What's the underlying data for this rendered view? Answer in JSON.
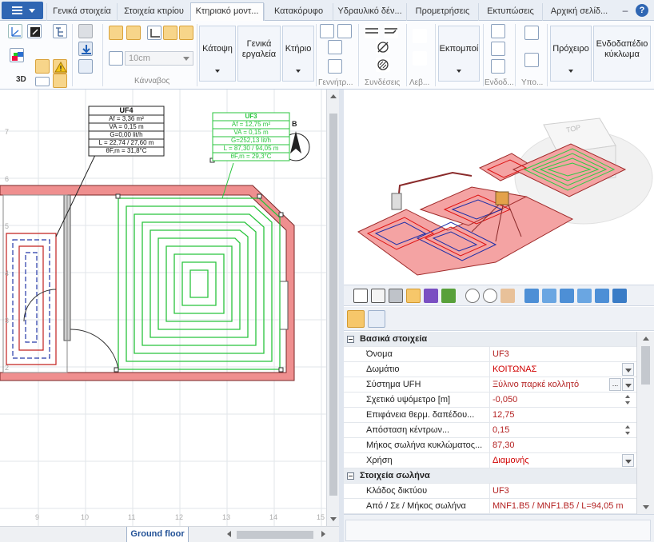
{
  "tabs": [
    {
      "label": "Γενικά στοιχεία",
      "active": false
    },
    {
      "label": "Στοιχεία κτιρίου",
      "active": false
    },
    {
      "label": "Κτηριακό μοντ...",
      "active": true
    },
    {
      "label": "Κατακόρυφο",
      "active": false
    },
    {
      "label": "Υδραυλικό δέν...",
      "active": false
    },
    {
      "label": "Προμετρήσεις",
      "active": false
    },
    {
      "label": "Εκτυπώσεις",
      "active": false
    },
    {
      "label": "Αρχική σελίδ...",
      "active": false
    }
  ],
  "window_controls": {
    "minimize": "–",
    "help": "?"
  },
  "ribbon": {
    "label_3d": "3D",
    "thickness_value": "10cm",
    "group_canvas": "Κάνναβος",
    "btn_katopsi": "Κάτοψη",
    "btn_genika_line1": "Γενικά",
    "btn_genika_line2": "εργαλεία",
    "btn_ktirio": "Κτήριο",
    "group_generators": "Γεννήτρ...",
    "group_connections": "Συνδέσεις",
    "group_boilers": "Λεβ...",
    "btn_emitters": "Εκπομποί",
    "group_endod": "Ενδοδ...",
    "group_ypo": "Υπο...",
    "btn_draft": "Πρόχειρο",
    "btn_floor_line1": "Ενδοδαπέδιο",
    "btn_floor_line2": "κύκλωμα"
  },
  "plan": {
    "box_uf4": {
      "title": "UF4",
      "lines": [
        "Af = 3,36 m²",
        "VA = 0,15 m",
        "G=0,00 lit/h",
        "L = 22,74 / 27,60 m",
        "θF,m = 31,8°C"
      ]
    },
    "box_uf3": {
      "title": "UF3",
      "lines": [
        "Af = 12,75 m²",
        "VA = 0,15 m",
        "G=252,13 lit/h",
        "L = 87,30 / 94,05 m",
        "θF,m = 29,3°C"
      ]
    },
    "north_label": "B",
    "ruler_left": [
      "7",
      "6",
      "5",
      "4",
      "3",
      "2"
    ],
    "ruler_bottom": [
      "9",
      "10",
      "11",
      "12",
      "13",
      "14",
      "15"
    ],
    "floor_tab": "Ground floor"
  },
  "view3d": {
    "top_label": "TOP"
  },
  "properties": {
    "categories": [
      "Βασικά στοιχεία",
      "Στοιχεία σωλήνα"
    ],
    "rows": [
      {
        "name": "Όνομα",
        "value": "UF3"
      },
      {
        "name": "Δωμάτιο",
        "value": "ΚΟΙΤΩΝΑΣ"
      },
      {
        "name": "Σύστημα UFH",
        "value": "Ξύλινο παρκέ κολλητό"
      },
      {
        "name": "Σχετικό υψόμετρο [m]",
        "value": "-0,050"
      },
      {
        "name": "Επιφάνεια θερμ. δαπέδου...",
        "value": "12,75"
      },
      {
        "name": "Απόσταση κέντρων...",
        "value": "0,15"
      },
      {
        "name": "Μήκος σωλήνα κυκλώματος...",
        "value": "87,30"
      },
      {
        "name": "Χρήση",
        "value": "Διαμονής"
      },
      {
        "name": "Κλάδος δικτύου",
        "value": "UF3"
      },
      {
        "name": "Από / Σε / Μήκος σωλήνα",
        "value": "MNF1.B5 / MNF1.B5 / L=94,05 m"
      }
    ]
  },
  "colors": {
    "accent": "#2f66b3",
    "pipe_green": "#2ecc40",
    "wall_red": "#ee8a8a",
    "value_red": "#b42222"
  }
}
